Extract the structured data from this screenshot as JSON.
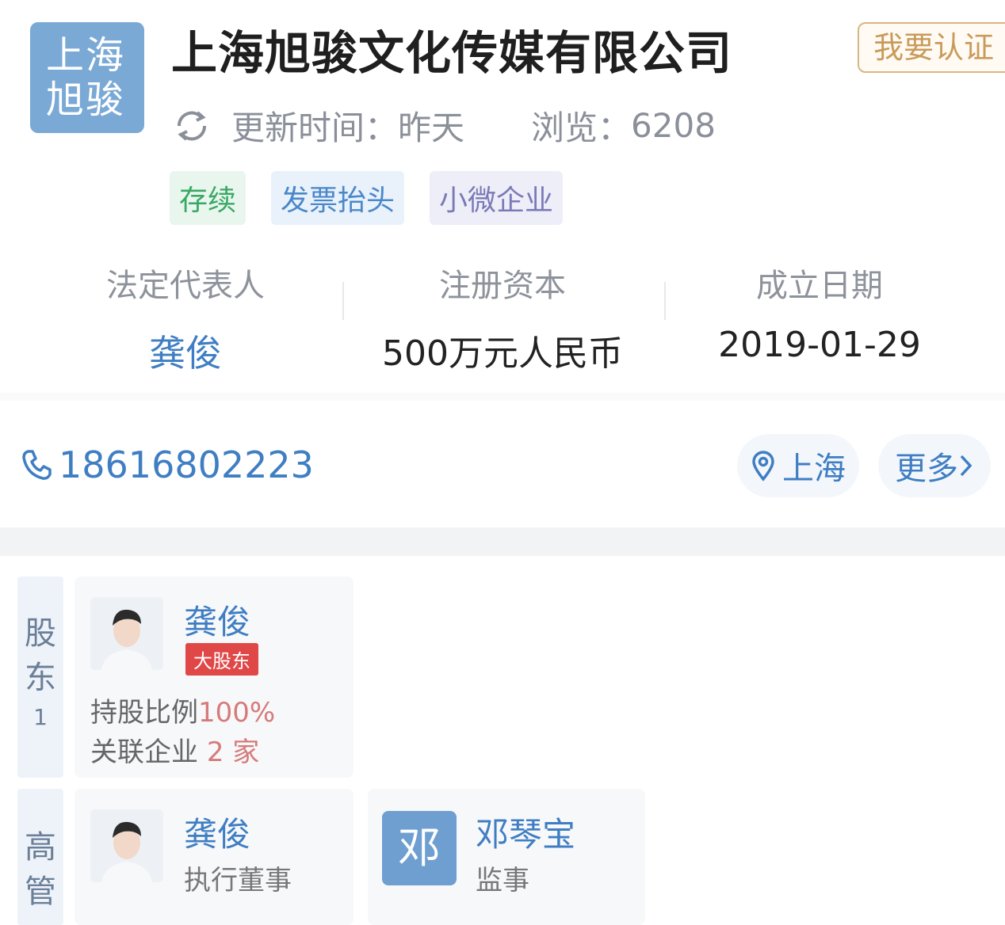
{
  "header": {
    "logo_line1": "上海",
    "logo_line2": "旭骏",
    "company_name": "上海旭骏文化传媒有限公司",
    "cert_button": "我要认证",
    "update_label": "更新时间：",
    "update_value": "昨天",
    "views_label": "浏览：",
    "views_value": "6208"
  },
  "tags": [
    "存续",
    "发票抬头",
    "小微企业"
  ],
  "info": [
    {
      "label": "法定代表人",
      "value": "龚俊"
    },
    {
      "label": "注册资本",
      "value": "500万元人民币"
    },
    {
      "label": "成立日期",
      "value": "2019-01-29"
    }
  ],
  "contact": {
    "phone": "18616802223",
    "location": "上海",
    "more": "更多"
  },
  "shareholders": {
    "tab_line1": "股",
    "tab_line2": "东",
    "count": "1",
    "items": [
      {
        "name": "龚俊",
        "badge": "大股东",
        "ratio_label": "持股比例",
        "ratio_value": "100%",
        "related_label": "关联企业",
        "related_count": "2",
        "related_unit": "家"
      }
    ]
  },
  "executives": {
    "tab_line1": "高",
    "tab_line2": "管",
    "items": [
      {
        "name": "龚俊",
        "role": "执行董事"
      },
      {
        "name": "邓琴宝",
        "role": "监事",
        "avatar_letter": "邓"
      }
    ]
  },
  "colors": {
    "accent": "#3f7ec3",
    "logo_bg": "#7aa9d6",
    "badge_red": "#e04848",
    "tag_green": "#3aa865",
    "cert_gold": "#c99b5a"
  },
  "icons": {
    "update": "refresh-icon",
    "phone": "phone-icon",
    "location": "location-pin-icon",
    "more": "chevron-right-icon"
  }
}
